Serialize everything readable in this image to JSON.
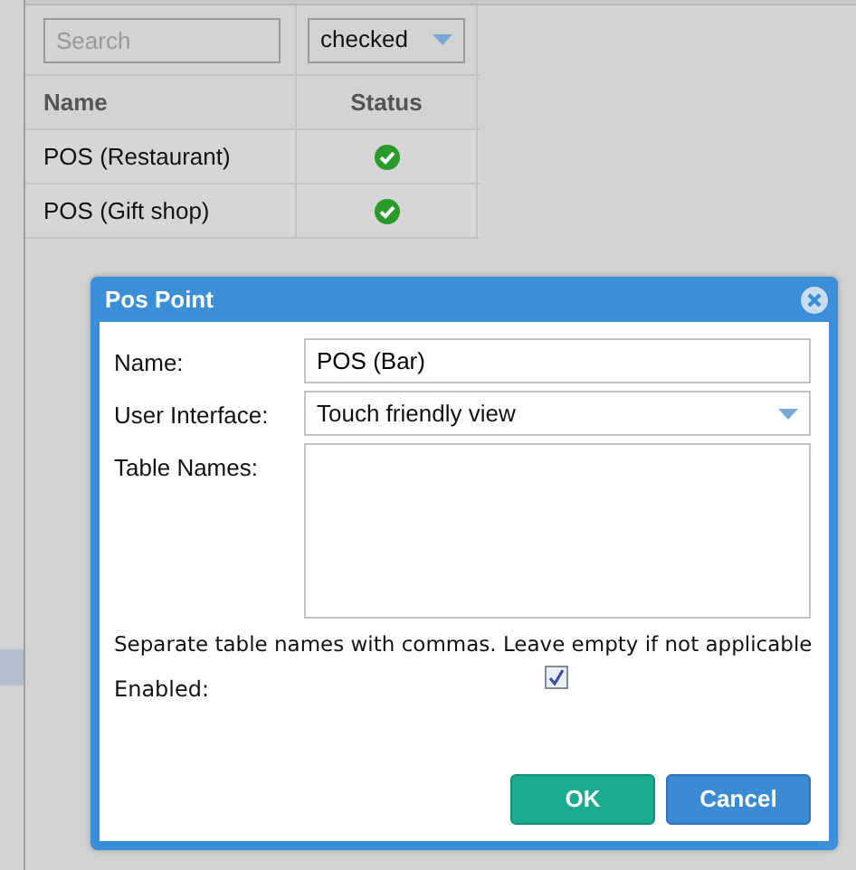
{
  "grid": {
    "search": {
      "placeholder": "Search"
    },
    "status_filter": "checked",
    "columns": [
      "Name",
      "Status"
    ],
    "rows": [
      {
        "name": "POS (Restaurant)",
        "checked": true
      },
      {
        "name": "POS (Gift shop)",
        "checked": true
      }
    ]
  },
  "dialog": {
    "title": "Pos Point",
    "fields": [
      {
        "kind": "text",
        "label": "Name:",
        "value": "POS (Bar)"
      },
      {
        "kind": "select",
        "label": "User Interface:",
        "value": "Touch friendly view"
      },
      {
        "kind": "textarea",
        "label": "Table Names:"
      }
    ],
    "hint": "Separate table names with commas. Leave empty if not applicable",
    "enabled": {
      "label": "Enabled:",
      "checked": true
    },
    "buttons": [
      {
        "label": "OK",
        "kind": "primary"
      },
      {
        "label": "Cancel",
        "kind": "secondary"
      }
    ]
  }
}
